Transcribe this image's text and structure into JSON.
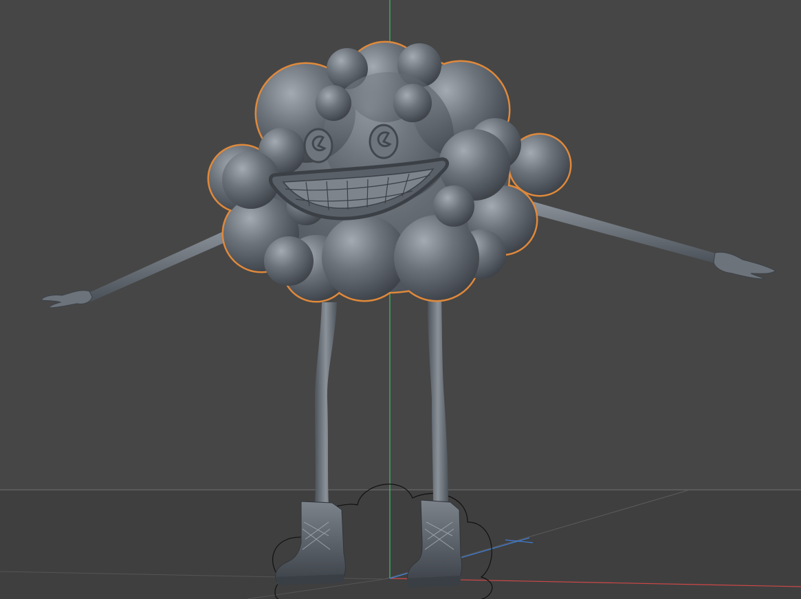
{
  "viewport": {
    "view": "perspective",
    "shading": "grey clay",
    "selected_object": "cloud-body",
    "colors": {
      "background": "#464646",
      "floor": "#3f3f3f",
      "model": "#6b7178",
      "model_highlight": "#9aa1a8",
      "model_shadow": "#3b4046",
      "selection_outline": "#e0893a",
      "axis_x": "#d04848",
      "axis_y": "#3fbf6a",
      "axis_z": "#3f7fd8",
      "spline": "#111111"
    },
    "icons": {
      "axis_gizmo": "world-axes-icon",
      "floor_grid": "floor-grid-icon",
      "spline_object": "cloud-spline-icon"
    }
  }
}
